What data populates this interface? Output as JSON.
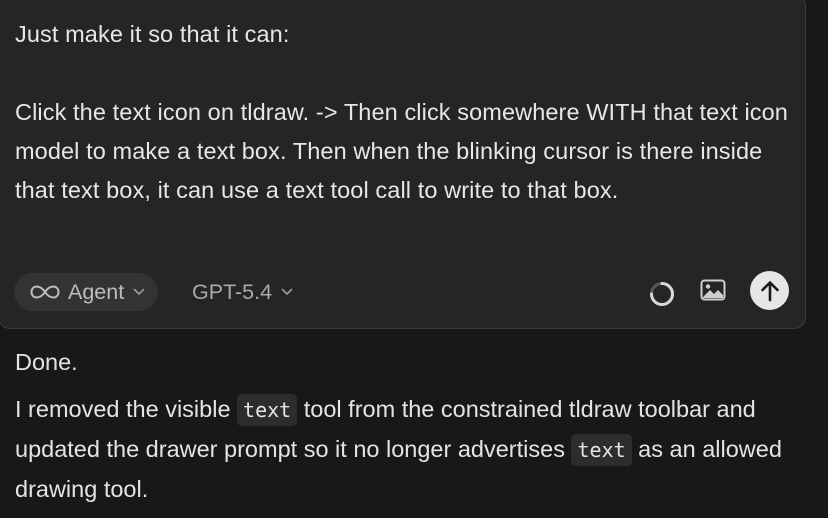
{
  "composer": {
    "prompt_text": "Just make it so that it can:\n\nClick the text icon on tldraw. -> Then click somewhere WITH that text icon model to make a text box. Then when the blinking cursor is there inside that text box, it can use a text tool call to write to that box.",
    "mode_icon": "infinity-icon",
    "mode_label": "Agent",
    "model_label": "GPT-5.4",
    "loading_icon": "spinner-icon",
    "image_icon": "image-icon",
    "send_icon": "arrow-up-icon"
  },
  "response": {
    "line1": "Done.",
    "p2_part1": "I removed the visible ",
    "code1": "text",
    "p2_part2": " tool from the constrained tldraw toolbar and updated the drawer prompt so it no longer advertises ",
    "code2": "text",
    "p2_part3": " as an allowed drawing tool."
  },
  "colors": {
    "background": "#181818",
    "composer_bg": "#252525",
    "pill_bg": "#333333",
    "send_button": "#e6e6e6"
  }
}
